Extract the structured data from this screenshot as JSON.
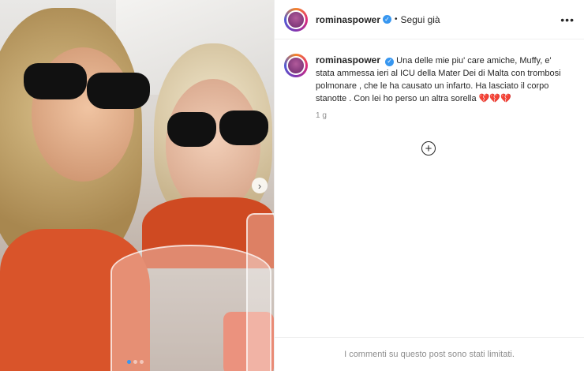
{
  "post": {
    "username": "rominaspower",
    "follow_label": "Segui già",
    "separator": "•",
    "more_label": "•••",
    "caption": "Una delle mie piu' care amiche, Muffy, e' stata ammessa ieri al ICU della Mater Dei di Malta con trombosi polmonare , che le ha causato un infarto. Ha lasciato il corpo stanotte . Con lei ho perso un altra sorella 💔💔💔",
    "time": "1 g",
    "add_label": "+",
    "comments_limited": "I commenti su questo post sono stati limitati."
  },
  "carousel": {
    "next_label": "›",
    "slide_count": 3,
    "active_slide": 1
  },
  "colors": {
    "verified": "#3897f0",
    "muted_text": "#8e8e8e"
  }
}
